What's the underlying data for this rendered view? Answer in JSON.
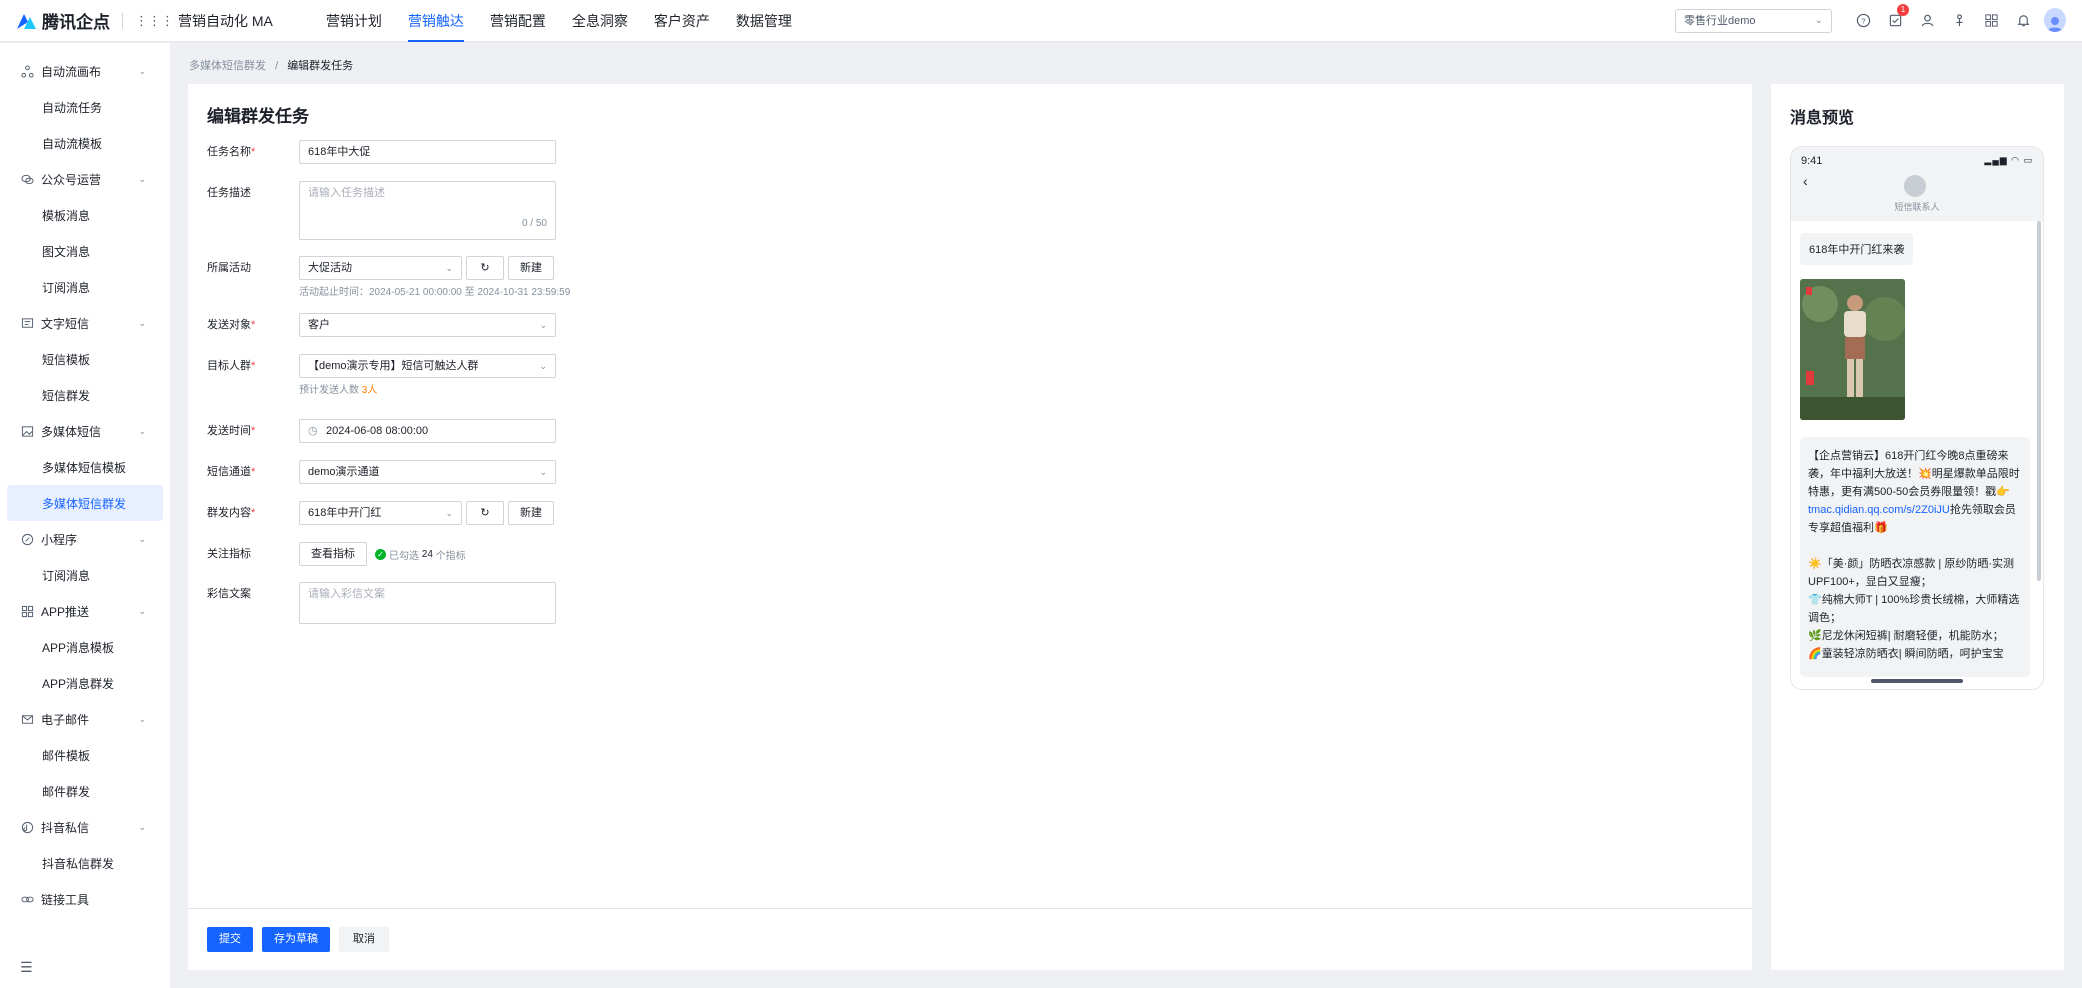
{
  "header": {
    "logo_text": "腾讯企点",
    "app_title": "营销自动化 MA",
    "nav": [
      "营销计划",
      "营销触达",
      "营销配置",
      "全息洞察",
      "客户资产",
      "数据管理"
    ],
    "active_nav": "营销触达",
    "tenant": "零售行业demo",
    "notification_count": "1"
  },
  "sidebar": {
    "groups": [
      {
        "label": "自动流画布",
        "icon": "flow-icon",
        "items": [
          "自动流任务",
          "自动流模板"
        ]
      },
      {
        "label": "公众号运营",
        "icon": "wechat-icon",
        "items": [
          "模板消息",
          "图文消息",
          "订阅消息"
        ]
      },
      {
        "label": "文字短信",
        "icon": "sms-icon",
        "items": [
          "短信模板",
          "短信群发"
        ]
      },
      {
        "label": "多媒体短信",
        "icon": "mms-icon",
        "items": [
          "多媒体短信模板",
          "多媒体短信群发"
        ]
      },
      {
        "label": "小程序",
        "icon": "miniprogram-icon",
        "items": [
          "订阅消息"
        ]
      },
      {
        "label": "APP推送",
        "icon": "app-icon",
        "items": [
          "APP消息模板",
          "APP消息群发"
        ]
      },
      {
        "label": "电子邮件",
        "icon": "mail-icon",
        "items": [
          "邮件模板",
          "邮件群发"
        ]
      },
      {
        "label": "抖音私信",
        "icon": "douyin-icon",
        "items": [
          "抖音私信群发"
        ]
      },
      {
        "label": "链接工具",
        "icon": "link-icon",
        "items": []
      }
    ],
    "active_item": "多媒体短信群发"
  },
  "breadcrumb": {
    "parent": "多媒体短信群发",
    "separator": "/",
    "current": "编辑群发任务"
  },
  "form": {
    "title": "编辑群发任务",
    "task_name": {
      "label": "任务名称",
      "value": "618年中大促"
    },
    "task_desc": {
      "label": "任务描述",
      "placeholder": "请输入任务描述",
      "counter": "0 / 50"
    },
    "activity": {
      "label": "所属活动",
      "value": "大促活动",
      "new_label": "新建",
      "time_hint": "活动起止时间：2024-05-21 00:00:00 至 2024-10-31 23:59:59"
    },
    "target": {
      "label": "发送对象",
      "value": "客户"
    },
    "audience": {
      "label": "目标人群",
      "value": "【demo演示专用】短信可触达人群",
      "hint_prefix": "预计发送人数",
      "hint_count": "3人"
    },
    "send_time": {
      "label": "发送时间",
      "value": "2024-06-08 08:00:00"
    },
    "channel": {
      "label": "短信通道",
      "value": "demo演示通道"
    },
    "content": {
      "label": "群发内容",
      "value": "618年中开门红",
      "new_label": "新建"
    },
    "metrics": {
      "label": "关注指标",
      "button": "查看指标",
      "selected_prefix": "已勾选",
      "selected_count": "24",
      "selected_suffix": "个指标"
    },
    "mms_copy": {
      "label": "彩信文案",
      "placeholder": "请输入彩信文案"
    },
    "buttons": {
      "submit": "提交",
      "draft": "存为草稿",
      "cancel": "取消"
    }
  },
  "preview": {
    "title": "消息预览",
    "time": "9:41",
    "contact": "短信联系人",
    "subject": "618年中开门红来袭",
    "body_lines": [
      "【企点营销云】618开门红今晚8点重磅来袭，年中福利大放送！💥明星爆款单品限时特惠，更有满500-50会员券限量领！戳👉",
      "tmac.qidian.qq.com/s/2Z0iJU",
      "抢先领取会员专享超值福利🎁",
      "☀️「美·颜」防晒衣凉感款 | 原纱防晒·实测UPF100+，显白又显瘦；",
      "👕纯棉大师T | 100%珍贵长绒棉，大师精选调色；",
      "🌿尼龙休闲短裤| 耐磨轻便，机能防水；",
      "🌈童装轻凉防晒衣| 瞬间防晒，呵护宝宝"
    ]
  },
  "colors": {
    "accent": "#1664ff",
    "required": "#f53f3f",
    "highlight": "#ff7d00",
    "success": "#00b42a"
  }
}
